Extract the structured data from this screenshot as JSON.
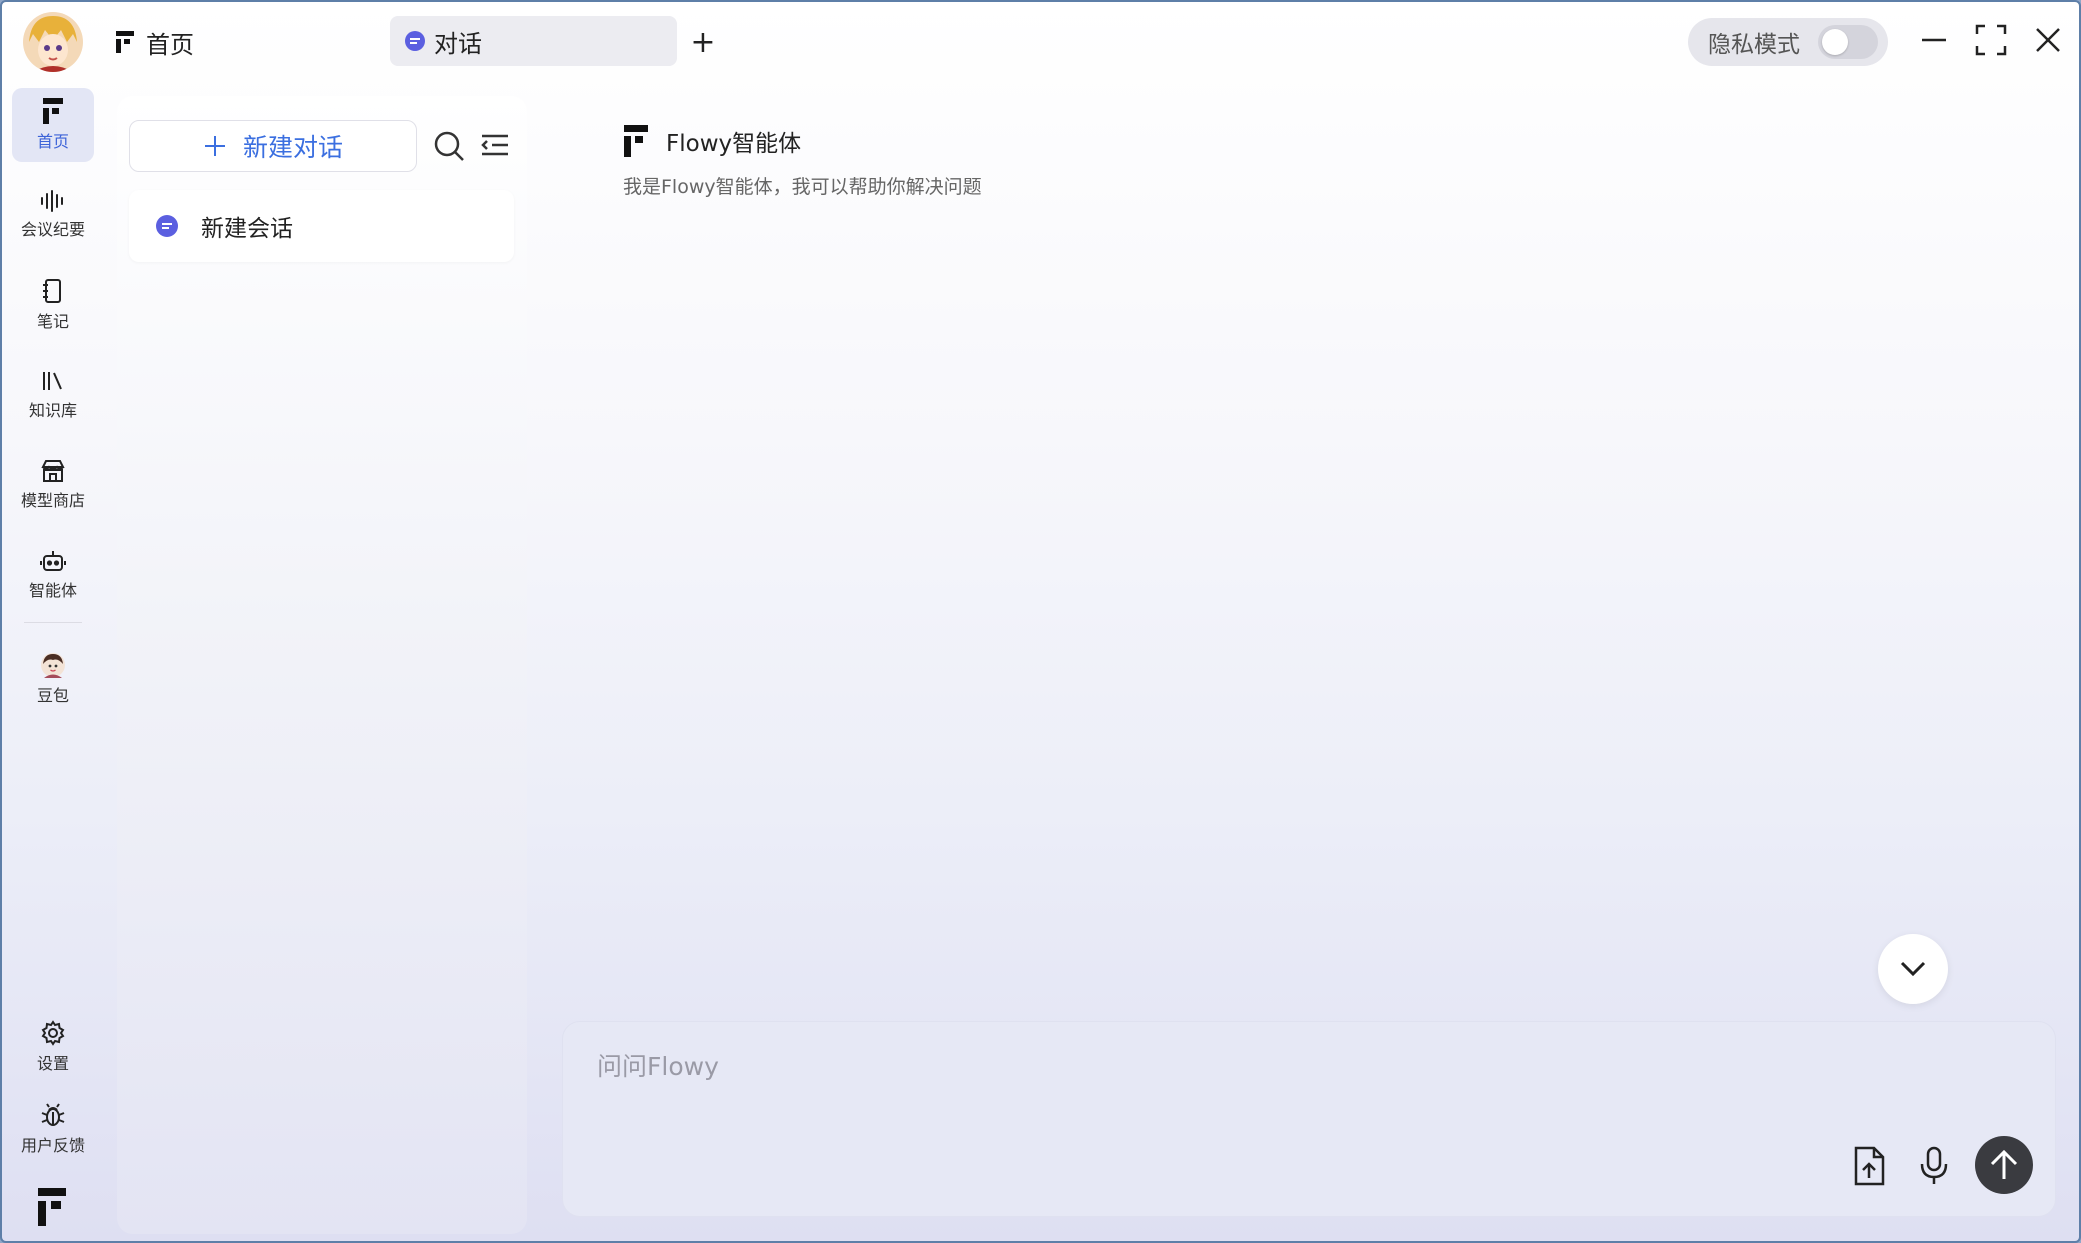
{
  "titlebar": {
    "home_tab_label": "首页",
    "active_tab_label": "对话",
    "add_tab_label": "+",
    "privacy_label": "隐私模式",
    "privacy_enabled": false
  },
  "rail": {
    "items": [
      {
        "label": "首页",
        "icon": "flowy-logo-icon",
        "active": true
      },
      {
        "label": "会议纪要",
        "icon": "waveform-icon",
        "active": false
      },
      {
        "label": "笔记",
        "icon": "notebook-icon",
        "active": false
      },
      {
        "label": "知识库",
        "icon": "library-icon",
        "active": false
      },
      {
        "label": "模型商店",
        "icon": "store-icon",
        "active": false
      },
      {
        "label": "智能体",
        "icon": "robot-icon",
        "active": false
      },
      {
        "label": "豆包",
        "icon": "doubao-avatar-icon",
        "active": false
      }
    ],
    "bottom": [
      {
        "label": "设置",
        "icon": "gear-icon"
      },
      {
        "label": "用户反馈",
        "icon": "bug-icon"
      }
    ]
  },
  "list_panel": {
    "new_chat_label": "新建对话",
    "sessions": [
      {
        "title": "新建会话"
      }
    ]
  },
  "main": {
    "agent_name": "Flowy智能体",
    "agent_description": "我是Flowy智能体，我可以帮助你解决问题",
    "composer_placeholder": "问问Flowy"
  },
  "colors": {
    "accent": "#3b6fe0",
    "chat_icon": "#5b5fe0",
    "send_button": "#3a3b40"
  }
}
